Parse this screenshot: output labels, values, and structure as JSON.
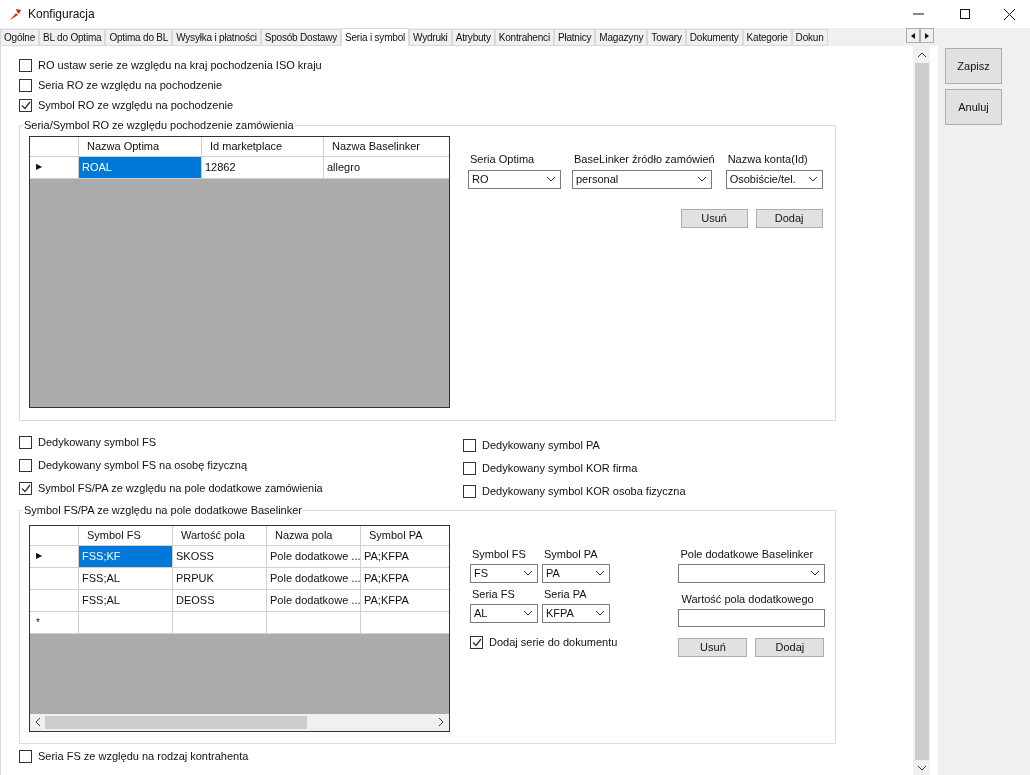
{
  "window": {
    "title": "Konfiguracja"
  },
  "tabs": [
    {
      "label": "Ogólne",
      "selected": false
    },
    {
      "label": "BL do Optima",
      "selected": false
    },
    {
      "label": "Optima do BL",
      "selected": false
    },
    {
      "label": "Wysyłka i płatności",
      "selected": false
    },
    {
      "label": "Sposób Dostawy",
      "selected": false
    },
    {
      "label": "Seria i symbol",
      "selected": true
    },
    {
      "label": "Wydruki",
      "selected": false
    },
    {
      "label": "Atrybuty",
      "selected": false
    },
    {
      "label": "Kontrahenci",
      "selected": false
    },
    {
      "label": "Płatnicy",
      "selected": false
    },
    {
      "label": "Magazyny",
      "selected": false
    },
    {
      "label": "Towary",
      "selected": false
    },
    {
      "label": "Dokumenty",
      "selected": false
    },
    {
      "label": "Kategorie",
      "selected": false
    },
    {
      "label": "Dokun",
      "selected": false
    }
  ],
  "top_checkboxes": [
    {
      "label": "RO ustaw serie ze względu na kraj pochodzenia ISO kraju",
      "checked": false
    },
    {
      "label": "Seria RO ze względu na pochodzenie",
      "checked": false
    },
    {
      "label": "Symbol RO ze względu na pochodzenie",
      "checked": true
    }
  ],
  "group_ro": {
    "title": "Seria/Symbol RO ze względu pochodzenie zamówienia",
    "grid": {
      "columns": [
        "Nazwa Optima",
        "Id marketplace",
        "Nazwa Baselinker"
      ],
      "rows": [
        {
          "kind": "data",
          "marker": "▶",
          "cells": [
            {
              "text": "ROAL",
              "selected": true
            },
            {
              "text": "12862",
              "selected": false
            },
            {
              "text": "allegro",
              "selected": false
            }
          ]
        }
      ]
    },
    "fields": [
      {
        "label": "Seria Optima",
        "value": "RO"
      },
      {
        "label": "BaseLinker źródło zamówień",
        "value": "personal"
      },
      {
        "label": "Nazwa konta(Id)",
        "value": "Osobiście/tel."
      }
    ],
    "buttons": [
      "Usuń",
      "Dodaj"
    ]
  },
  "middle_checkboxes_left": [
    {
      "label": "Dedykowany symbol FS",
      "checked": false
    },
    {
      "label": "Dedykowany symbol FS na osobę fizyczną",
      "checked": false
    },
    {
      "label": "Symbol FS/PA ze względu na pole dodatkowe zamówienia",
      "checked": true
    }
  ],
  "middle_checkboxes_right": [
    {
      "label": "Dedykowany symbol PA",
      "checked": false
    },
    {
      "label": "Dedykowany symbol KOR firma",
      "checked": false
    },
    {
      "label": "Dedykowany symbol KOR osoba fizyczna",
      "checked": false
    }
  ],
  "group_fs": {
    "title": "Symbol FS/PA ze względu na pole dodatkowe Baselinker",
    "grid": {
      "columns": [
        "Symbol FS",
        "Wartość pola",
        "Nazwa pola",
        "Symbol PA"
      ],
      "rows": [
        {
          "kind": "data",
          "marker": "▶",
          "cells": [
            {
              "text": "FSS;KF",
              "selected": true
            },
            {
              "text": "SKOSS",
              "selected": false
            },
            {
              "text": "Pole dodatkowe ...",
              "selected": false
            },
            {
              "text": "PA;KFPA",
              "selected": false
            }
          ]
        },
        {
          "kind": "data",
          "cells": [
            {
              "text": "FSS;AL",
              "selected": false
            },
            {
              "text": "PRPUK",
              "selected": false
            },
            {
              "text": "Pole dodatkowe ...",
              "selected": false
            },
            {
              "text": "PA;KFPA",
              "selected": false
            }
          ]
        },
        {
          "kind": "data",
          "cells": [
            {
              "text": "FSS;AL",
              "selected": false
            },
            {
              "text": "DEOSS",
              "selected": false
            },
            {
              "text": "Pole dodatkowe ...",
              "selected": false
            },
            {
              "text": "PA;KFPA",
              "selected": false
            }
          ]
        },
        {
          "kind": "new",
          "marker": "*"
        }
      ]
    },
    "series_fields": [
      {
        "label": "Symbol FS",
        "value": "FS"
      },
      {
        "label": "Symbol PA",
        "value": "PA"
      },
      {
        "label": "Seria FS",
        "value": "AL"
      },
      {
        "label": "Seria PA",
        "value": "KFPA"
      }
    ],
    "add_series_checkbox": {
      "label": "Dodaj serie do dokumentu",
      "checked": true
    },
    "extra_field": {
      "label": "Pole dodatkowe Baselinker"
    },
    "extra_value": {
      "label": "Wartość pola dodatkowego"
    },
    "buttons": [
      "Usuń",
      "Dodaj"
    ]
  },
  "bottom_checkbox": {
    "label": "Seria FS ze względu na rodzaj kontrahenta",
    "checked": false
  },
  "side_buttons": [
    "Zapisz",
    "Anuluj"
  ]
}
